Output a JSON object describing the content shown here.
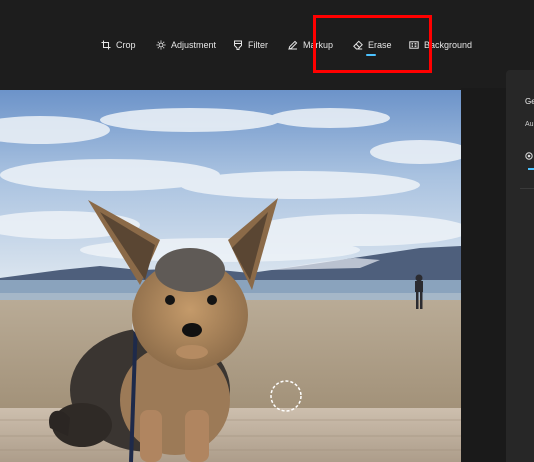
{
  "toolbar": {
    "tools": [
      {
        "label": "Crop",
        "icon": "crop-icon"
      },
      {
        "label": "Adjustment",
        "icon": "brightness-icon"
      },
      {
        "label": "Filter",
        "icon": "filter-icon"
      },
      {
        "label": "Markup",
        "icon": "pen-icon"
      },
      {
        "label": "Erase",
        "icon": "eraser-icon",
        "active": true
      },
      {
        "label": "Background",
        "icon": "background-icon"
      }
    ]
  },
  "side_panel": {
    "title": "Ge",
    "subtitle": "Au"
  },
  "colors": {
    "app_background": "#1d1d1d",
    "panel_background": "#272727",
    "accent": "#4cc2ff",
    "highlight_box": "#ff0000"
  }
}
